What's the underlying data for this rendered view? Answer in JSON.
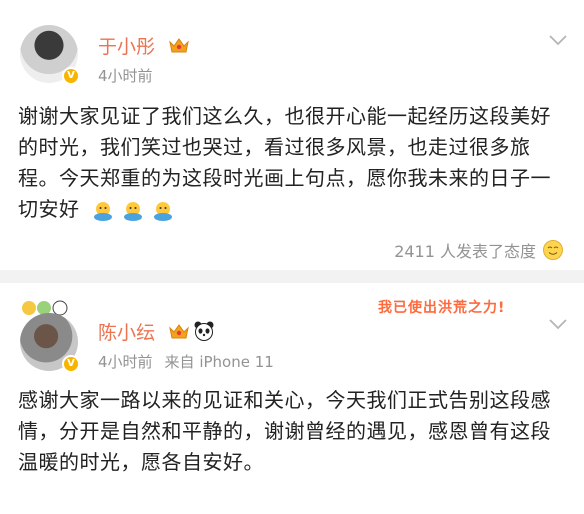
{
  "posts": [
    {
      "author": "于小彤",
      "time": "4小时前",
      "source": "",
      "body": "谢谢大家见证了我们这么久，也很开心能一起经历这段美好的时光，我们笑过也哭过，看过很多风景，也走过很多旅程。今天郑重的为这段时光画上句点，愿你我未来的日子一切安好",
      "reaction_text": "2411 人发表了态度"
    },
    {
      "author": "陈小纭",
      "time": "4小时前",
      "source": "来自 iPhone 11",
      "body": "感谢大家一路以来的见证和关心，今天我们正式告别这段感情，分开是自然和平静的，谢谢曾经的遇见，感恩曾有这段温暖的时光，愿各自安好。",
      "sticker_text": "我已使出洪荒之力!"
    }
  ],
  "icons": {
    "vip_badge": "crown-icon",
    "verified": "v-badge-icon",
    "menu": "chevron-down-icon",
    "hug_emoji": "hug-emoji-icon",
    "reaction": "smile-face-icon",
    "panda": "panda-icon"
  },
  "colors": {
    "name": "#eb7350",
    "meta": "#939393",
    "badge": "#f7b500",
    "divider": "#f2f2f2"
  }
}
